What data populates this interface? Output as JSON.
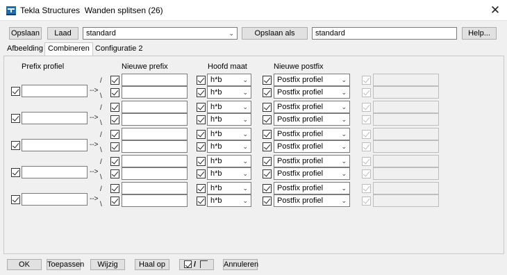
{
  "window": {
    "app": "Tekla Structures",
    "dialog": "Wanden splitsen (26)",
    "close": "✕"
  },
  "toolbar": {
    "save": "Opslaan",
    "load": "Laad",
    "preset": "standard",
    "save_as": "Opslaan als",
    "save_as_name": "standard",
    "help": "Help..."
  },
  "tabs": [
    "Afbeelding",
    "Combineren",
    "Configuratie 2"
  ],
  "active_tab": "Combineren",
  "headers": {
    "prefix_profiel": "Prefix profiel",
    "nieuwe_prefix": "Nieuwe prefix",
    "hoofd_maat": "Hoofd maat",
    "nieuwe_postfix": "Nieuwe postfix"
  },
  "connector": {
    "arrow": "-->",
    "up": "/",
    "down": "\\"
  },
  "groups": [
    {
      "prefix": "",
      "rows": [
        {
          "new_prefix": "",
          "size": "h*b",
          "postfix": "Postfix profiel",
          "extra": ""
        },
        {
          "new_prefix": "",
          "size": "h*b",
          "postfix": "Postfix profiel",
          "extra": ""
        }
      ]
    },
    {
      "prefix": "",
      "rows": [
        {
          "new_prefix": "",
          "size": "h*b",
          "postfix": "Postfix profiel",
          "extra": ""
        },
        {
          "new_prefix": "",
          "size": "h*b",
          "postfix": "Postfix profiel",
          "extra": ""
        }
      ]
    },
    {
      "prefix": "",
      "rows": [
        {
          "new_prefix": "",
          "size": "h*b",
          "postfix": "Postfix profiel",
          "extra": ""
        },
        {
          "new_prefix": "",
          "size": "h*b",
          "postfix": "Postfix profiel",
          "extra": ""
        }
      ]
    },
    {
      "prefix": "",
      "rows": [
        {
          "new_prefix": "",
          "size": "h*b",
          "postfix": "Postfix profiel",
          "extra": ""
        },
        {
          "new_prefix": "",
          "size": "h*b",
          "postfix": "Postfix profiel",
          "extra": ""
        }
      ]
    },
    {
      "prefix": "",
      "rows": [
        {
          "new_prefix": "",
          "size": "h*b",
          "postfix": "Postfix profiel",
          "extra": ""
        },
        {
          "new_prefix": "",
          "size": "h*b",
          "postfix": "Postfix profiel",
          "extra": ""
        }
      ]
    }
  ],
  "footer": {
    "ok": "OK",
    "apply": "Toepassen",
    "modify": "Wijzig",
    "get": "Haal op",
    "toggle": "/",
    "cancel": "Annuleren"
  },
  "colors": {
    "app_icon": "#1e6db3",
    "window_bg": "#f0f0f0",
    "button_bg": "#e1e1e1"
  }
}
